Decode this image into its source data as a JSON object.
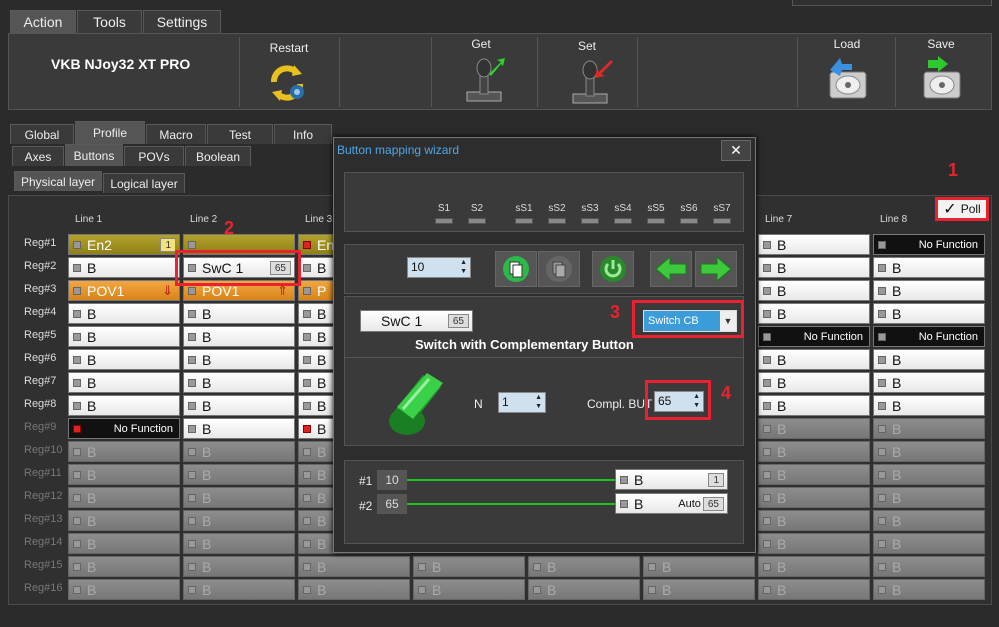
{
  "menu": {
    "tabs": [
      "Action",
      "Tools",
      "Settings"
    ]
  },
  "toolbar": {
    "device_name": "VKB NJoy32 XT PRO",
    "restart_label": "Restart",
    "get_label": "Get",
    "set_label": "Set",
    "load_label": "Load",
    "save_label": "Save"
  },
  "tabs_main": [
    "Global",
    "Profile",
    "Macro",
    "Test",
    "Info"
  ],
  "tabs_sub": [
    "Axes",
    "Buttons",
    "POVs",
    "Boolean"
  ],
  "tabs_layer": [
    "Physical layer",
    "Logical layer"
  ],
  "poll_label": "Poll",
  "annotations": [
    "1",
    "2",
    "3",
    "4"
  ],
  "lines": [
    "Line 1",
    "Line 2",
    "Line 3",
    "Line 7",
    "Line 8"
  ],
  "regs": [
    "Reg#1",
    "Reg#2",
    "Reg#3",
    "Reg#4",
    "Reg#5",
    "Reg#6",
    "Reg#7",
    "Reg#8",
    "Reg#9",
    "Reg#10",
    "Reg#11",
    "Reg#12",
    "Reg#13",
    "Reg#14",
    "Reg#15",
    "Reg#16"
  ],
  "cells": {
    "en2": "En2",
    "en2_badge": "1",
    "b": "B",
    "swc": "SwC  1",
    "swc_badge": "65",
    "pov1": "POV1",
    "no_function": "No Function",
    "p_partial": "P",
    "en_partial": "En"
  },
  "dialog": {
    "title": "Button mapping wizard",
    "close": "✕",
    "switches": [
      "S1",
      "S2",
      "sS1",
      "sS2",
      "sS3",
      "sS4",
      "sS5",
      "sS6",
      "sS7"
    ],
    "index_value": "10",
    "swc_label": "SwC  1",
    "swc_badge": "65",
    "mode_value": "Switch CB",
    "mode_desc": "Switch with Complementary Button",
    "n_label": "N",
    "n_value": "1",
    "compl_label": "Compl. BUT",
    "compl_value": "65",
    "row1_num": "10",
    "row1_label": "#1",
    "row1_btn": "B",
    "row1_badge": "1",
    "row2_num": "65",
    "row2_label": "#2",
    "row2_btn": "B",
    "row2_auto": "Auto",
    "row2_badge": "65"
  },
  "colors": {
    "accent": "#4fa6e8",
    "annotation": "#e8232f",
    "connector": "#1ac41a"
  }
}
